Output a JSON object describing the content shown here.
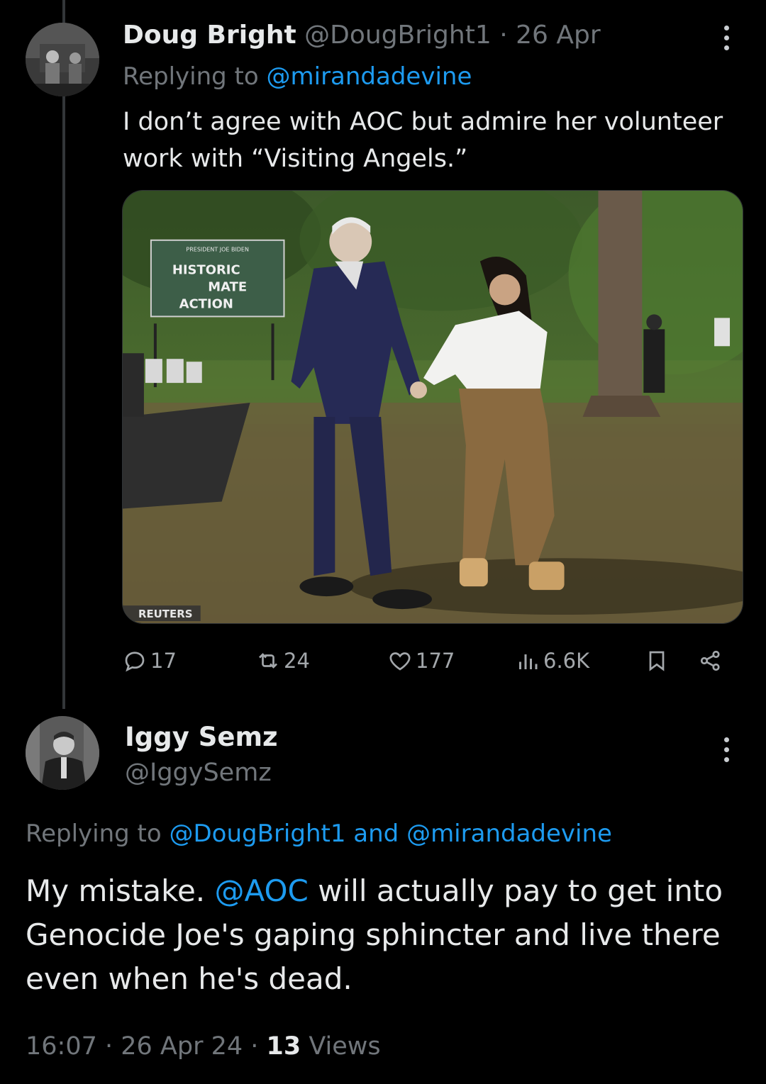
{
  "tweet1": {
    "author_name": "Doug Bright",
    "handle": "@DougBright1",
    "separator": "·",
    "date": "26 Apr",
    "replying_prefix": "Replying to ",
    "replying_to": "@mirandadevine",
    "text": "I don’t agree with AOC but admire her volunteer work with “Visiting Angels.”",
    "photo": {
      "sign_top": "PRESIDENT JOE BIDEN",
      "sign_line1": "HISTORIC",
      "sign_line2": "MATE",
      "sign_line3": "ACTION",
      "credit": "REUTERS"
    },
    "stats": {
      "replies": "17",
      "reposts": "24",
      "likes": "177",
      "views": "6.6K"
    }
  },
  "tweet2": {
    "author_name": "Iggy Semz",
    "handle": "@IggySemz",
    "replying_prefix": "Replying to ",
    "replying_to_1": "@DougBright1",
    "replying_and": " and ",
    "replying_to_2": "@mirandadevine",
    "text_before": "My mistake. ",
    "mention": "@AOC",
    "text_after": " will actually pay to get into Genocide Joe's gaping sphincter and live there even when he's dead.",
    "time": "16:07",
    "separator": " · ",
    "date": "26 Apr 24",
    "views_count": "13",
    "views_label": " Views"
  },
  "colors": {
    "background": "#000000",
    "text": "#e7e9ea",
    "muted": "#71767b",
    "link": "#1d9bf0"
  },
  "icons": [
    "more-icon",
    "reply-icon",
    "repost-icon",
    "like-icon",
    "views-icon",
    "bookmark-icon",
    "share-icon"
  ]
}
